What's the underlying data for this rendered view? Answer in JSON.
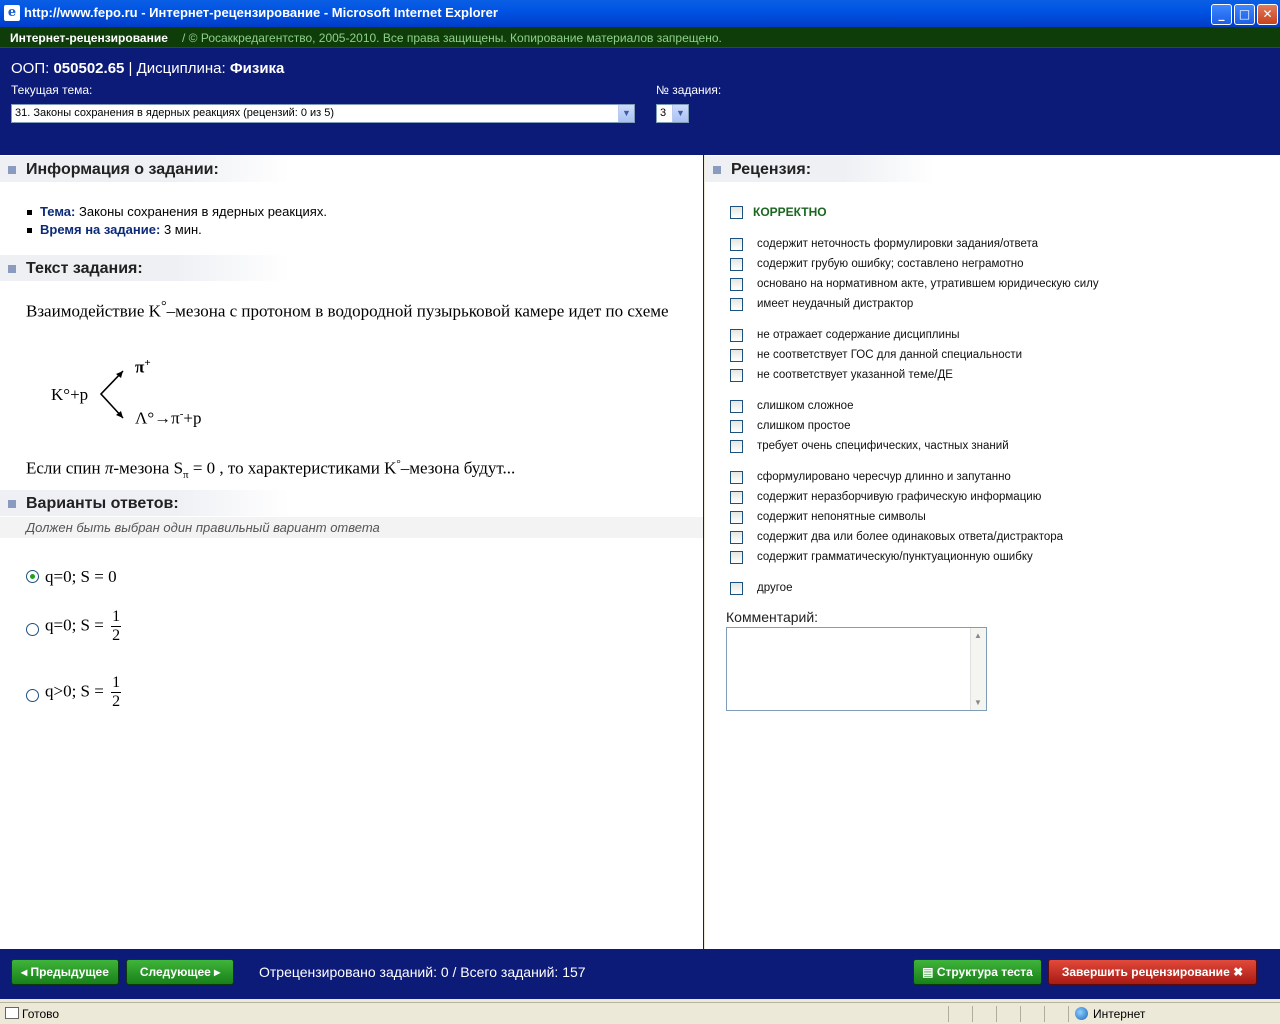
{
  "window": {
    "title": "http://www.fepo.ru - Интернет-рецензирование - Microsoft Internet Explorer",
    "minimize": "_",
    "maximize": "□",
    "close": "✕"
  },
  "site": {
    "brand": "Интернет-рецензирование",
    "copyright": "/  © Росаккредагентство, 2005-2010. Все права защищены. Копирование материалов запрещено."
  },
  "header": {
    "oop_label": "ООП:",
    "oop_value": "050502.65",
    "discipline_label": "| Дисциплина:",
    "discipline_value": "Физика",
    "topic_label": "Текущая тема:",
    "topic_value": "31. Законы сохранения в ядерных реакциях  (рецензий: 0 из 5)",
    "task_num_label": "№ задания:",
    "task_num_value": "3"
  },
  "info": {
    "heading": "Информация о задании:",
    "topic_key": "Тема:",
    "topic_val": "Законы сохранения в ядерных реакциях.",
    "time_key": "Время на задание:",
    "time_val": "3 мин."
  },
  "task": {
    "heading": "Текст задания:",
    "line1": "Взаимодействие K",
    "deg": "°",
    "line1b": "–мезона с протоном в водородной пузырьковой камере идет по схеме",
    "reaction_left": "K°+p",
    "reaction_top": "π",
    "reaction_top_sup": "+",
    "reaction_bottom": "Λ°→π",
    "reaction_bottom_sup": "-",
    "reaction_bottom_end": "+p",
    "question_a": "Если спин ",
    "question_pi": "π",
    "question_b": "-мезона  S",
    "question_sub": "π",
    "question_c": " = 0 , то характеристиками K",
    "question_deg": "°",
    "question_d": "–мезона будут..."
  },
  "answers": {
    "heading": "Варианты ответов:",
    "hint": "Должен быть выбран один правильный вариант ответа",
    "items": [
      {
        "text": "q=0;  S = 0",
        "num": "",
        "den": "",
        "checked": true
      },
      {
        "text": "q=0;  S =",
        "num": "1",
        "den": "2",
        "checked": false
      },
      {
        "text": "q>0;  S =",
        "num": "1",
        "den": "2",
        "checked": false
      }
    ]
  },
  "review": {
    "heading": "Рецензия:",
    "correct": "КОРРЕКТНО",
    "options": [
      "содержит неточность формулировки задания/ответа",
      "содержит грубую ошибку; составлено неграмотно",
      "основано на нормативном акте, утратившем юридическую силу",
      "имеет неудачный дистрактор",
      "не отражает содержание дисциплины",
      "не соответствует ГОС для данной специальности",
      "не соответствует указанной теме/ДЕ",
      "слишком сложное",
      "слишком простое",
      "требует очень специфических, частных знаний",
      "сформулировано чересчур длинно и запутанно",
      "содержит неразборчивую графическую информацию",
      "содержит непонятные символы",
      "содержит два или более одинаковых ответа/дистрактора",
      "содержит грамматическую/пунктуационную ошибку",
      "другое"
    ],
    "comment_label": "Комментарий:",
    "comment_value": ""
  },
  "footer": {
    "prev": "◂ Предыдущее",
    "next": "Следующее ▸",
    "counter": "Отрецензировано заданий: 0 / Всего заданий:  157",
    "structure": "▤ Структура теста",
    "finish": "Завершить рецензирование ✖"
  },
  "status": {
    "ready": "Готово",
    "zone": "Интернет"
  }
}
